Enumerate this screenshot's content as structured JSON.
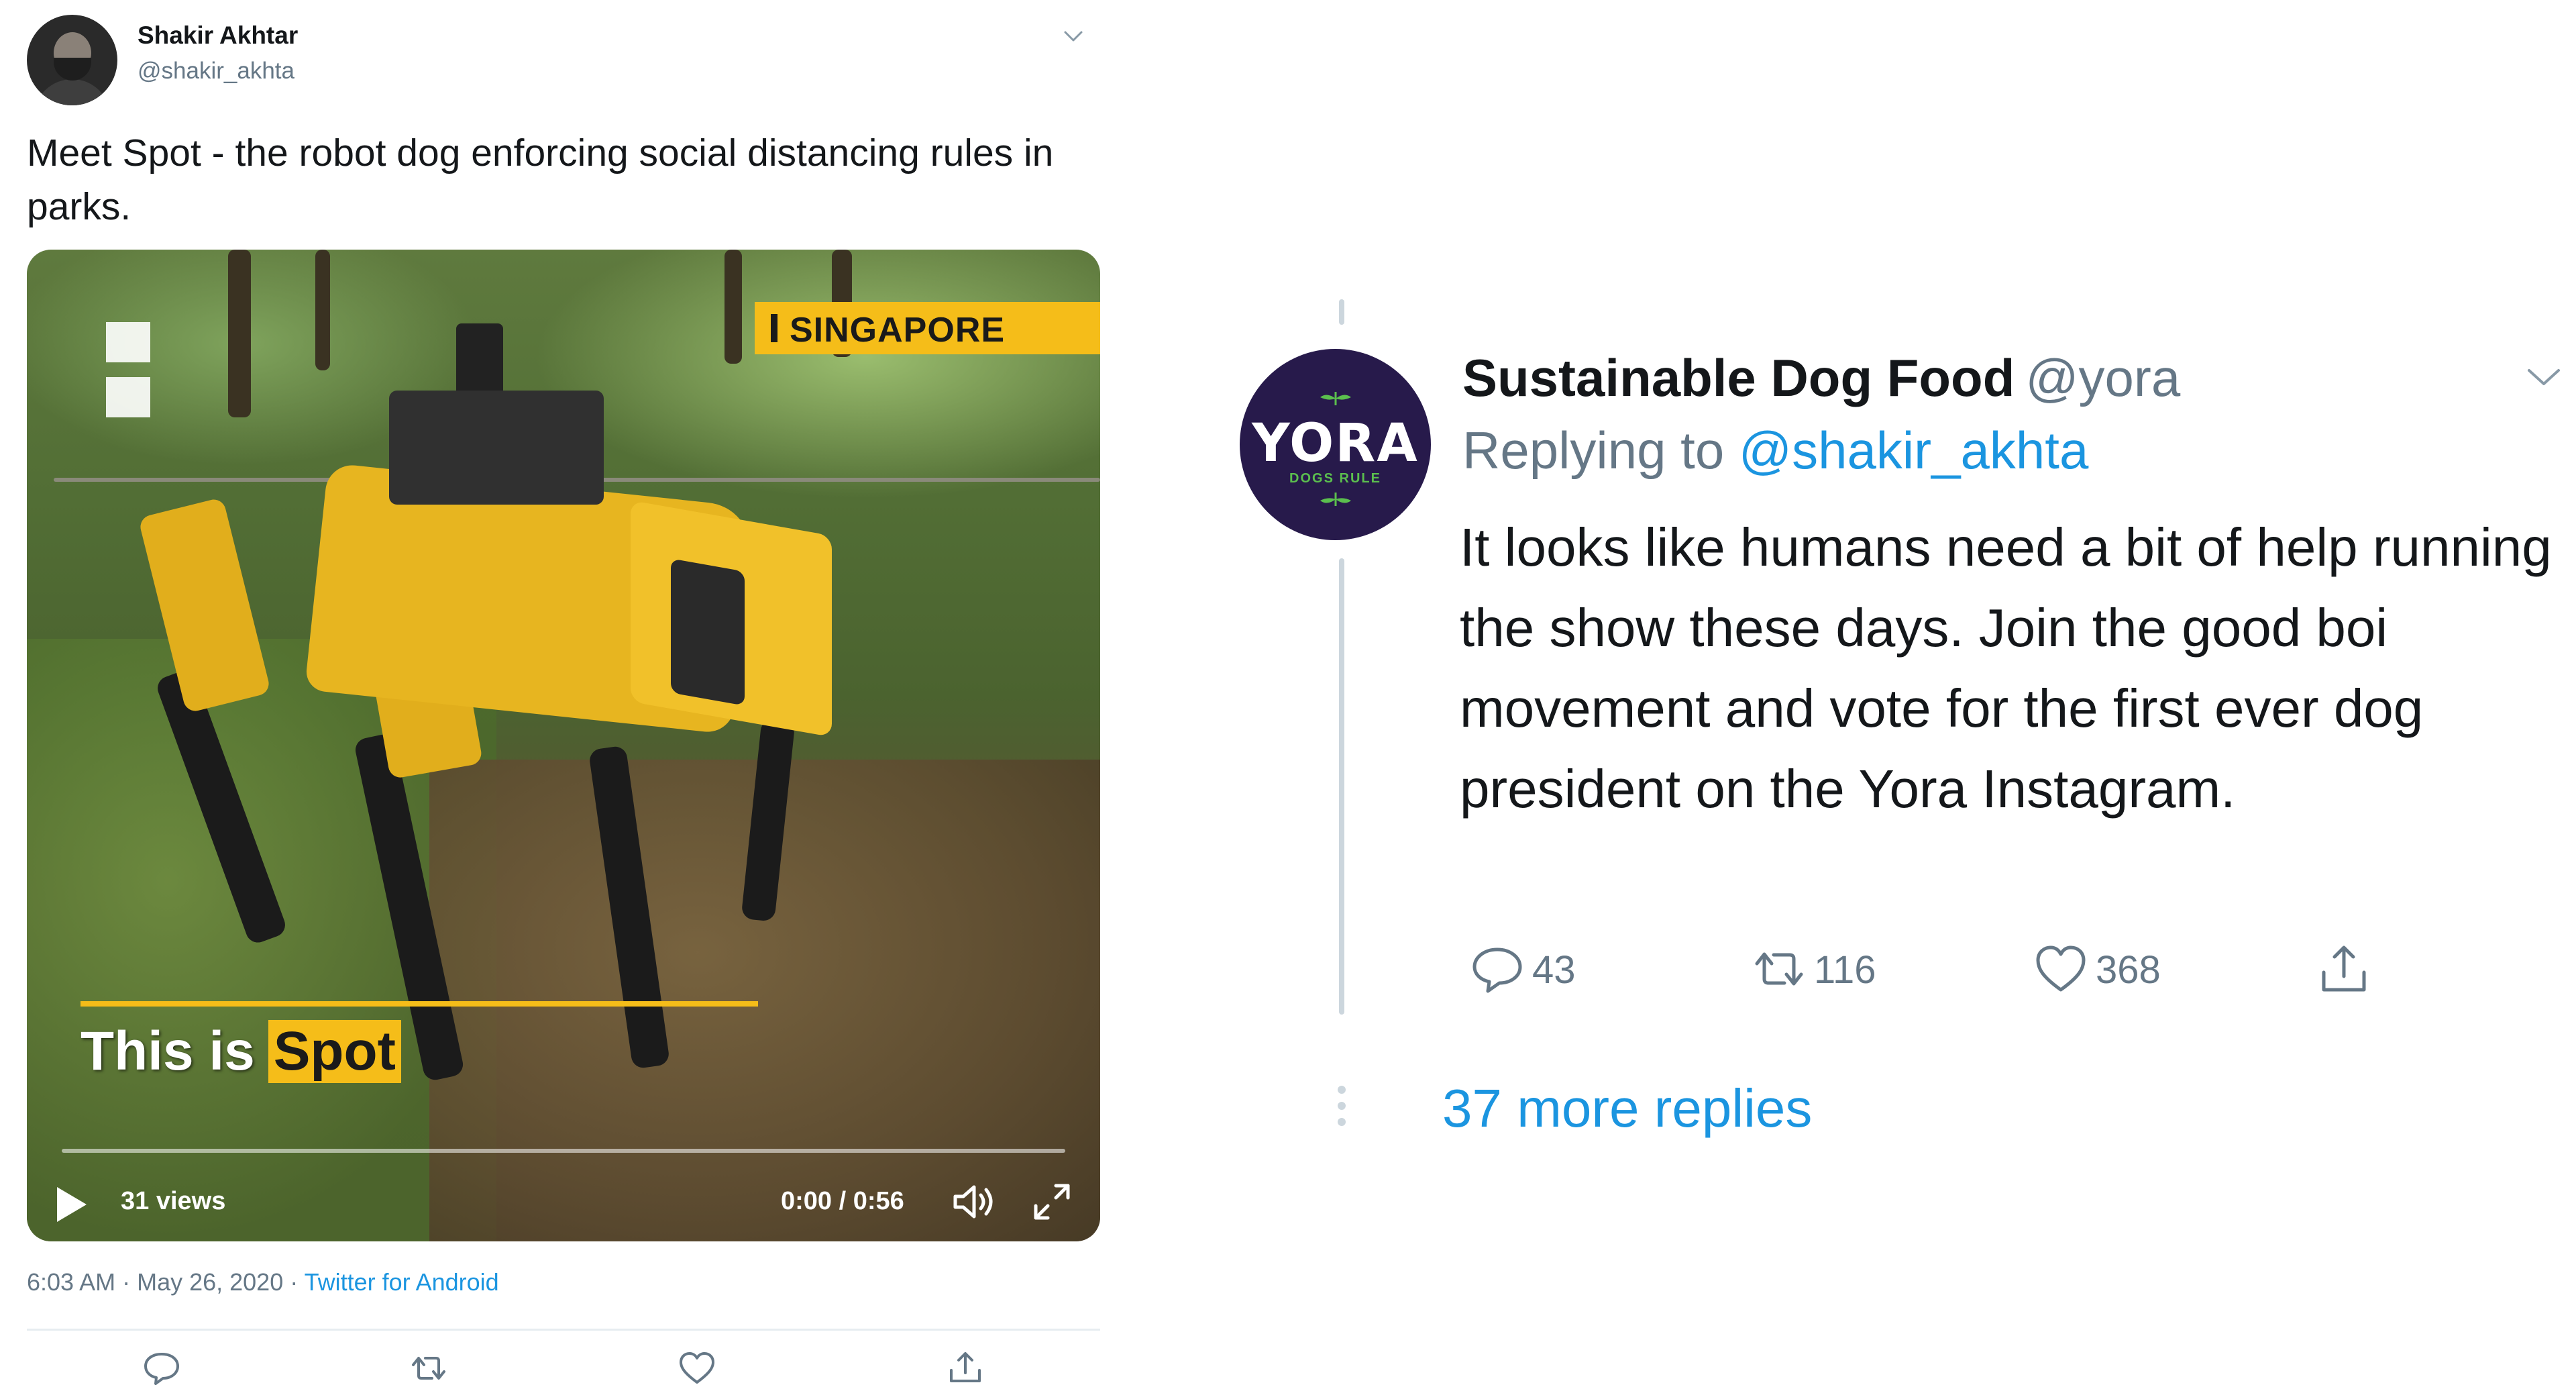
{
  "original_tweet": {
    "author_name": "Shakir Akhtar",
    "author_handle": "@shakir_akhta",
    "text": "Meet Spot - the robot dog enforcing social distancing rules in parks.",
    "video": {
      "location_tag": "SINGAPORE",
      "caption_prefix": "This is",
      "caption_highlight": "Spot",
      "views": "31 views",
      "time": "0:00 / 0:56"
    },
    "timestamp": "6:03 AM · May 26, 2020 · ",
    "source": "Twitter for Android",
    "actions": [
      "reply-icon",
      "retweet-icon",
      "like-icon",
      "share-icon"
    ]
  },
  "reply": {
    "avatar_logo": "YORA",
    "avatar_tagline": "DOGS RULE",
    "author_name": "Sustainable Dog Food",
    "author_handle": "@yora",
    "replying_prefix": "Replying to",
    "replying_mention": "@shakir_akhta",
    "text": "It looks like humans need a bit of help running the show these days. Join the good boi movement and vote for the first ever dog president on the Yora Instagram.",
    "counts": {
      "replies": "43",
      "retweets": "116",
      "likes": "368"
    },
    "more_replies": "37 more replies"
  },
  "colors": {
    "link": "#1b95e0",
    "muted": "#657786",
    "text": "#14171a",
    "thread_line": "#ccd6dd",
    "accent_yellow": "#f5bd19",
    "yora_purple": "#271a4b",
    "yora_green": "#5bbf4e"
  }
}
